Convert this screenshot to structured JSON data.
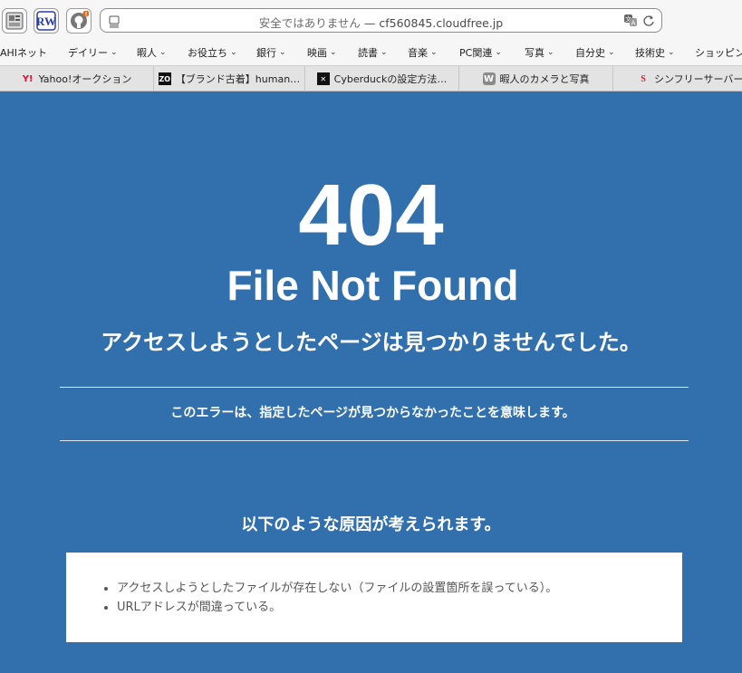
{
  "browser": {
    "url_security": "安全ではありません",
    "url_separator": "—",
    "url_host": "cf560845.cloudfree.jp",
    "extensions": [
      {
        "name": "bookmark-app-icon"
      },
      {
        "name": "rw-app-icon",
        "label": "RW"
      },
      {
        "name": "github-app-icon"
      }
    ]
  },
  "bookmarks": [
    {
      "label": "AHIネット",
      "menu": false
    },
    {
      "label": "デイリー",
      "menu": true
    },
    {
      "label": "暇人",
      "menu": true
    },
    {
      "label": "お役立ち",
      "menu": true
    },
    {
      "label": "銀行",
      "menu": true
    },
    {
      "label": "映画",
      "menu": true
    },
    {
      "label": "読書",
      "menu": true
    },
    {
      "label": "音楽",
      "menu": true
    },
    {
      "label": "PC関連",
      "menu": true
    },
    {
      "label": "写真",
      "menu": true
    },
    {
      "label": "自分史",
      "menu": true
    },
    {
      "label": "技術史",
      "menu": true
    },
    {
      "label": "ショッピング",
      "menu": false
    }
  ],
  "tabs": [
    {
      "label": "Yahoo!オークション",
      "favicon": "Y!",
      "color": "#ff0033"
    },
    {
      "label": "【ブランド古着】human…",
      "favicon": "ZO",
      "color": "#111111"
    },
    {
      "label": "Cyberduckの設定方法…",
      "favicon": "✕",
      "color": "#111111"
    },
    {
      "label": "暇人のカメラと写真",
      "favicon": "W",
      "color": "#8a8a8a"
    },
    {
      "label": "シンフリーサーバー | ネ",
      "favicon": "S",
      "color": "#cc2233"
    }
  ],
  "page": {
    "code": "404",
    "headline": "File Not Found",
    "message": "アクセスしようとしたページは見つかりませんでした。",
    "description": "このエラーは、指定したページが見つからなかったことを意味します。",
    "causes_title": "以下のような原因が考えられます。",
    "causes": [
      "アクセスしようとしたファイルが存在しない（ファイルの設置箇所を誤っている）。",
      "URLアドレスが間違っている。"
    ]
  },
  "colors": {
    "page_background": "#316fad",
    "text": "#ffffff",
    "box_background": "#ffffff",
    "box_text": "#555555"
  }
}
